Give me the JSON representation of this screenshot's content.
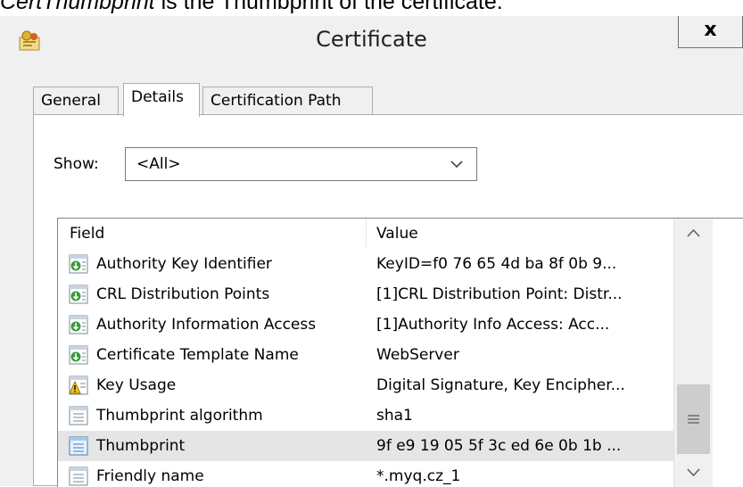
{
  "caption": {
    "italic": "CertThumbprint",
    "rest": " is the Thumbprint of the certificate."
  },
  "window": {
    "title": "Certificate",
    "close_label": "x",
    "icon": "certificate-icon"
  },
  "tabs": [
    {
      "label": "General",
      "active": false
    },
    {
      "label": "Details",
      "active": true
    },
    {
      "label": "Certification Path",
      "active": false
    }
  ],
  "show": {
    "label": "Show:",
    "selected": "<All>"
  },
  "list": {
    "columns": [
      "Field",
      "Value"
    ],
    "rows": [
      {
        "field": "Authority Key Identifier",
        "value": "KeyID=f0 76 65 4d ba 8f 0b 9...",
        "icon": "extension-icon"
      },
      {
        "field": "CRL Distribution Points",
        "value": "[1]CRL Distribution Point: Distr...",
        "icon": "extension-icon"
      },
      {
        "field": "Authority Information Access",
        "value": "[1]Authority Info Access: Acc...",
        "icon": "extension-icon"
      },
      {
        "field": "Certificate Template Name",
        "value": "WebServer",
        "icon": "extension-icon"
      },
      {
        "field": "Key Usage",
        "value": "Digital Signature, Key Encipher...",
        "icon": "critical-extension-icon"
      },
      {
        "field": "Thumbprint algorithm",
        "value": "sha1",
        "icon": "property-icon"
      },
      {
        "field": "Thumbprint",
        "value": "9f e9 19 05 5f 3c ed 6e 0b 1b ...",
        "icon": "property-icon",
        "selected": true
      },
      {
        "field": "Friendly name",
        "value": "*.myq.cz_1",
        "icon": "property-icon"
      }
    ]
  },
  "colors": {
    "window_bg": "#f0f0f0",
    "selected_row": "#e5e5e5",
    "icon_green": "#3a9a3a",
    "icon_yellow": "#f0c020"
  }
}
